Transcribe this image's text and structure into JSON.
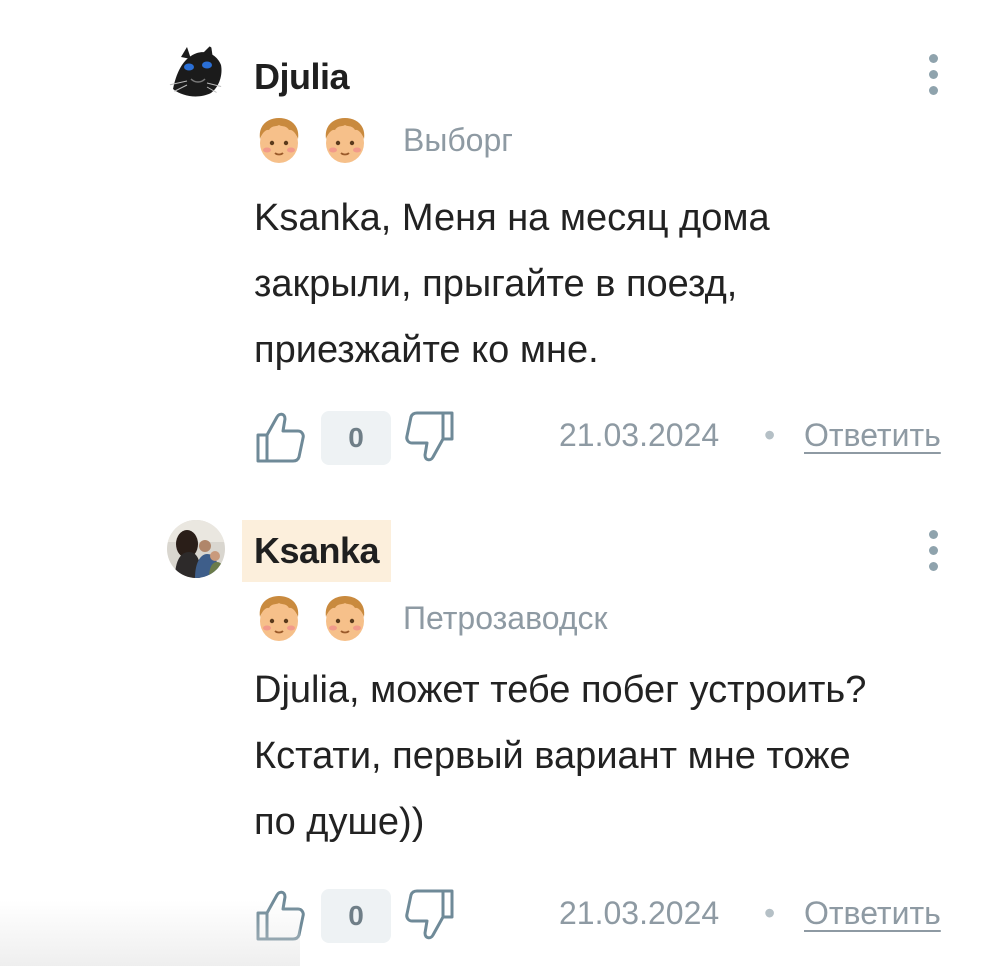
{
  "comments": [
    {
      "username": "Djulia",
      "city": "Выборг",
      "text": "Ksanka, Меня на месяц дома закрыли, прыгайте в поезд, приезжайте ко мне.",
      "likes": "0",
      "date": "21.03.2024",
      "separator": "•",
      "reply_label": "Ответить",
      "avatar_icon": "cat-avatar-icon",
      "badges": [
        "face-badge-icon",
        "face-badge-icon"
      ]
    },
    {
      "username": "Ksanka",
      "city": "Петрозаводск",
      "text": "Djulia, может тебе побег устроить? Кстати, первый вариант мне тоже по душе))",
      "likes": "0",
      "date": "21.03.2024",
      "separator": "•",
      "reply_label": "Ответить",
      "avatar_icon": "family-photo-avatar-icon",
      "badges": [
        "face-badge-icon",
        "face-badge-icon"
      ],
      "highlight_color": "#fcefdc"
    }
  ],
  "colors": {
    "muted_text": "#8e9aa3",
    "counter_bg": "#eef2f4",
    "icon_stroke": "#6f8a98"
  }
}
